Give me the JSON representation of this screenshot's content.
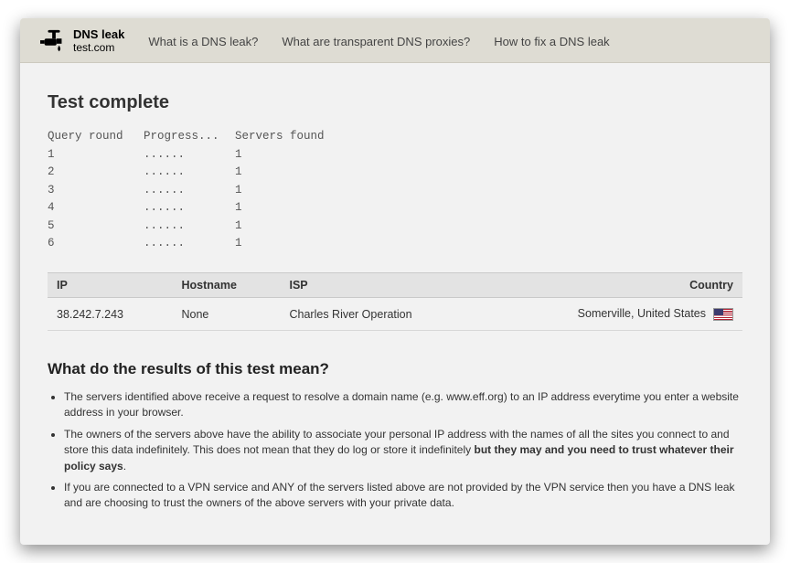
{
  "header": {
    "logo_line1": "DNS leak",
    "logo_line2": "test.com",
    "nav": [
      "What is a DNS leak?",
      "What are transparent DNS proxies?",
      "How to fix a DNS leak"
    ]
  },
  "test": {
    "title": "Test complete",
    "columns": {
      "round": "Query round",
      "progress": "Progress...",
      "found": "Servers found"
    },
    "rounds": [
      {
        "n": "1",
        "progress": "......",
        "found": "1"
      },
      {
        "n": "2",
        "progress": "......",
        "found": "1"
      },
      {
        "n": "3",
        "progress": "......",
        "found": "1"
      },
      {
        "n": "4",
        "progress": "......",
        "found": "1"
      },
      {
        "n": "5",
        "progress": "......",
        "found": "1"
      },
      {
        "n": "6",
        "progress": "......",
        "found": "1"
      }
    ]
  },
  "results": {
    "headers": {
      "ip": "IP",
      "hostname": "Hostname",
      "isp": "ISP",
      "country": "Country"
    },
    "rows": [
      {
        "ip": "38.242.7.243",
        "hostname": "None",
        "isp": "Charles River Operation",
        "country": "Somerville, United States",
        "flag": "us"
      }
    ]
  },
  "explain": {
    "title": "What do the results of this test mean?",
    "items": [
      {
        "text": "The servers identified above receive a request to resolve a domain name (e.g. www.eff.org) to an IP address everytime you enter a website address in your browser."
      },
      {
        "text_pre": "The owners of the servers above have the ability to associate your personal IP address with the names of all the sites you connect to and store this data indefinitely. This does not mean that they do log or store it indefinitely ",
        "bold": "but they may and you need to trust whatever their policy says",
        "text_post": "."
      },
      {
        "text": "If you are connected to a VPN service and ANY of the servers listed above are not provided by the VPN service then you have a DNS leak and are choosing to trust the owners of the above servers with your private data."
      }
    ]
  }
}
